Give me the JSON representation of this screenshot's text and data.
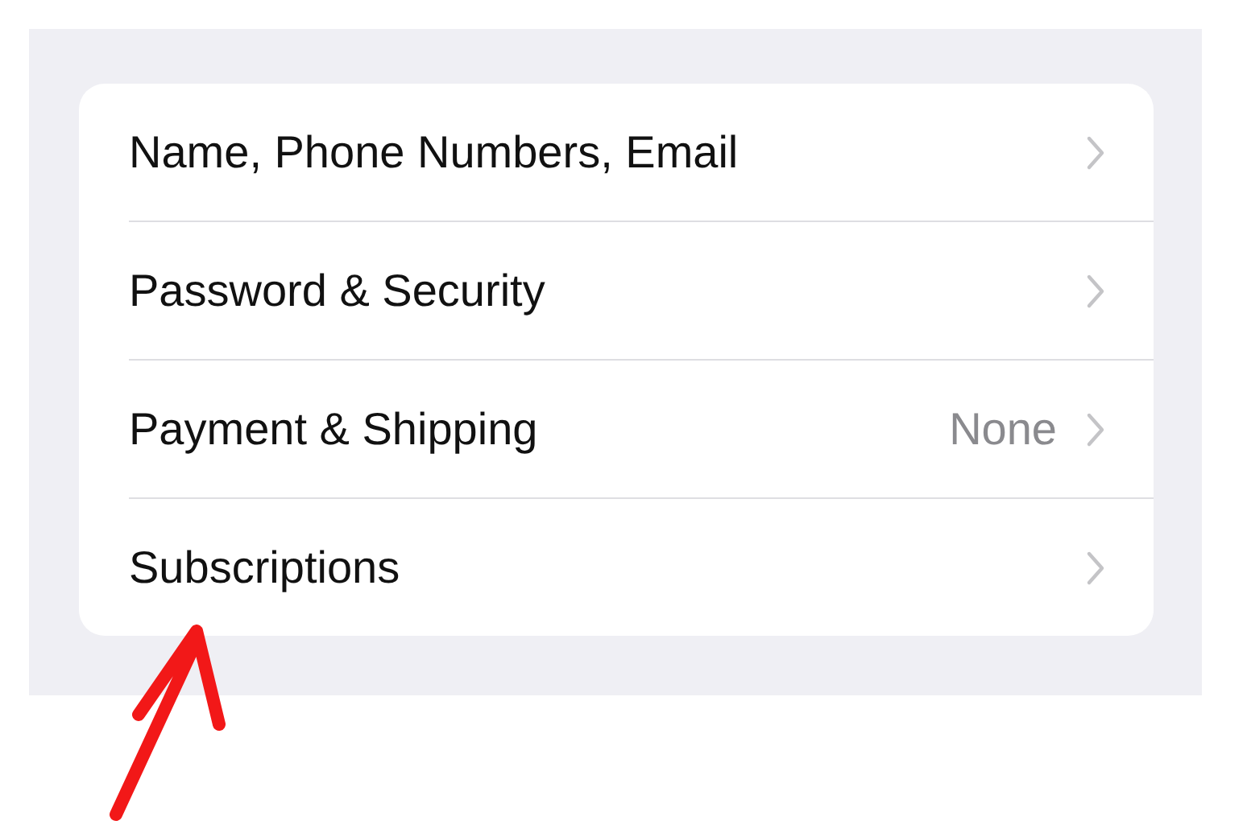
{
  "settings_list": [
    {
      "label": "Name, Phone Numbers, Email"
    },
    {
      "label": "Password & Security"
    },
    {
      "label": "Payment & Shipping",
      "value": "None"
    },
    {
      "label": "Subscriptions"
    }
  ]
}
